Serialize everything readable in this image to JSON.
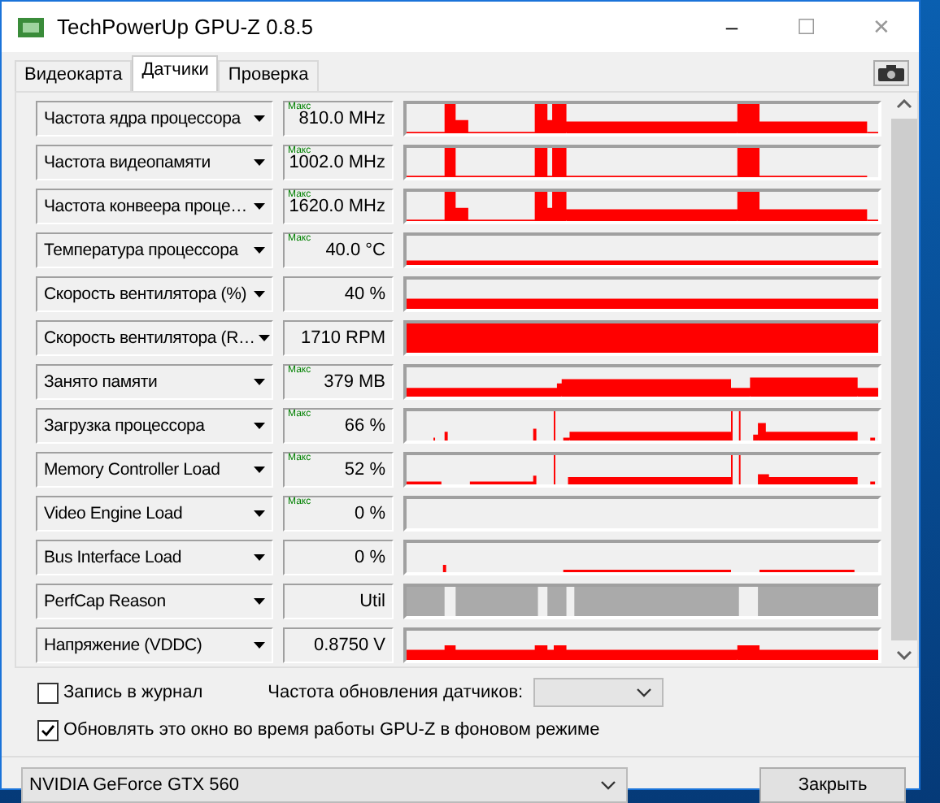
{
  "window": {
    "title": "TechPowerUp GPU-Z 0.8.5",
    "controls": [
      "–",
      "☐",
      "✕"
    ]
  },
  "tabs": [
    {
      "label": "Видеокарта",
      "selected": false
    },
    {
      "label": "Датчики",
      "selected": true
    },
    {
      "label": "Проверка",
      "selected": false
    }
  ],
  "sensors": [
    {
      "name": "Частота ядра процессора",
      "badge": "Макс",
      "value": "810.0 MHz",
      "kind": "history"
    },
    {
      "name": "Частота видеопамяти",
      "badge": "Макс",
      "value": "1002.0 MHz",
      "kind": "history"
    },
    {
      "name": "Частота конвеера проце…",
      "badge": "Макс",
      "value": "1620.0 MHz",
      "kind": "history"
    },
    {
      "name": "Температура процессора",
      "badge": "Макс",
      "value": "40.0 °C",
      "kind": "history"
    },
    {
      "name": "Скорость вентилятора (%)",
      "value": "40 %",
      "kind": "history"
    },
    {
      "name": "Скорость вентилятора (R…",
      "value": "1710 RPM",
      "kind": "history"
    },
    {
      "name": "Занято памяти",
      "badge": "Макс",
      "value": "379 MB",
      "kind": "history"
    },
    {
      "name": "Загрузка процессора",
      "badge": "Макс",
      "value": "66 %",
      "kind": "history"
    },
    {
      "name": "Memory Controller Load",
      "badge": "Макс",
      "value": "52 %",
      "kind": "history"
    },
    {
      "name": "Video Engine Load",
      "badge": "Макс",
      "value": "0 %",
      "kind": "history"
    },
    {
      "name": "Bus Interface Load",
      "value": "0 %",
      "kind": "history"
    },
    {
      "name": "PerfCap Reason",
      "value": "Util",
      "kind": "state"
    },
    {
      "name": "Напряжение (VDDC)",
      "value": "0.8750 V",
      "kind": "history"
    }
  ],
  "log": {
    "label": "Запись в журнал",
    "checked": false
  },
  "refresh": {
    "label": "Частота обновления датчиков:"
  },
  "background": {
    "label": "Обновлять это окно во время работы GPU-Z в фоновом режиме",
    "checked": true
  },
  "device": {
    "value": "NVIDIA GeForce GTX 560"
  },
  "close_button": "Закрыть"
}
